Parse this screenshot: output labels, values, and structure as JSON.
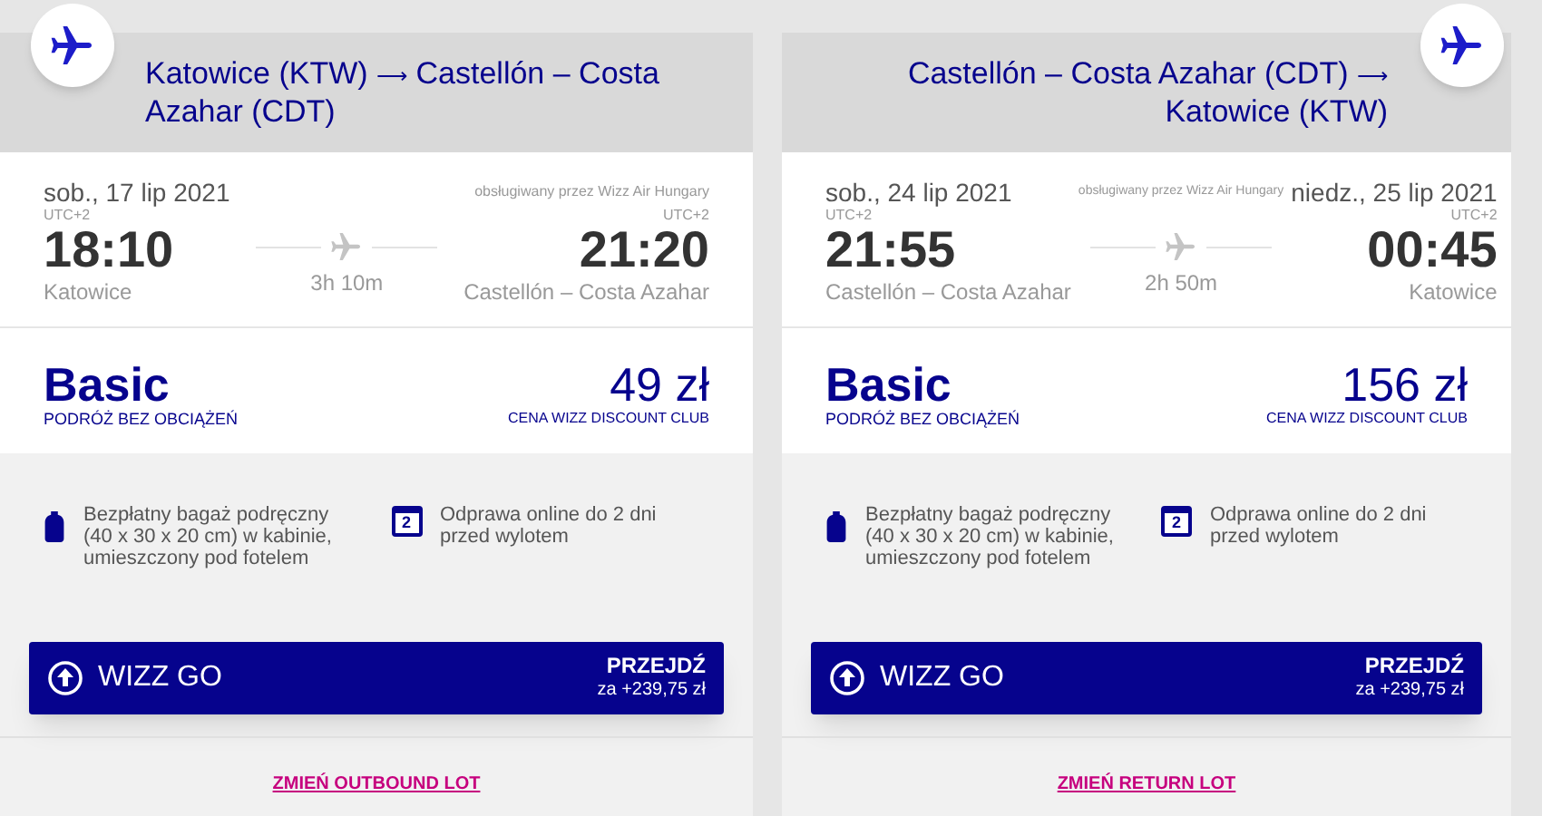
{
  "cards": [
    {
      "kind": "outbound",
      "route": {
        "from": "Katowice (KTW)",
        "arrow": "⟶",
        "to": "Castellón – Costa Azahar (CDT)"
      },
      "flight": {
        "departure": {
          "date": "sob., 17 lip 2021",
          "tz": "UTC+2",
          "time": "18:10",
          "city": "Katowice"
        },
        "arrival": {
          "tz": "UTC+2",
          "time": "21:20",
          "city": "Castellón – Costa Azahar"
        },
        "duration": "3h 10m",
        "operator": "obsługiwany przez Wizz Air Hungary"
      },
      "fare": {
        "name": "Basic",
        "subtitle": "PODRÓŻ BEZ OBCIĄŻEŃ",
        "price": "49 zł",
        "price_note": "CENA WIZZ DISCOUNT CLUB"
      },
      "features": [
        {
          "kind": "bag",
          "text": "Bezpłatny bagaż podręczny (40 x 30 x 20 cm) w kabinie, umieszczony pod fotelem"
        },
        {
          "kind": "calendar",
          "icon_text": "2",
          "text": "Odprawa online do 2 dni przed wylotem"
        }
      ],
      "upgrade": {
        "label": "WIZZ GO",
        "action": "PRZEJDŹ",
        "price": "za +239,75 zł"
      },
      "change_link": "ZMIEŃ OUTBOUND LOT"
    },
    {
      "kind": "return",
      "route": {
        "from": "Castellón – Costa Azahar (CDT)",
        "arrow": "⟶",
        "to": "Katowice (KTW)"
      },
      "flight": {
        "departure": {
          "date": "sob., 24 lip 2021",
          "tz": "UTC+2",
          "time": "21:55",
          "city": "Castellón – Costa Azahar"
        },
        "arrival": {
          "date": "niedz., 25 lip 2021",
          "tz": "UTC+2",
          "time": "00:45",
          "city": "Katowice"
        },
        "duration": "2h 50m",
        "operator": "obsługiwany przez Wizz Air Hungary"
      },
      "fare": {
        "name": "Basic",
        "subtitle": "PODRÓŻ BEZ OBCIĄŻEŃ",
        "price": "156 zł",
        "price_note": "CENA WIZZ DISCOUNT CLUB"
      },
      "features": [
        {
          "kind": "bag",
          "text": "Bezpłatny bagaż podręczny (40 x 30 x 20 cm) w kabinie, umieszczony pod fotelem"
        },
        {
          "kind": "calendar",
          "icon_text": "2",
          "text": "Odprawa online do 2 dni przed wylotem"
        }
      ],
      "upgrade": {
        "label": "WIZZ GO",
        "action": "PRZEJDŹ",
        "price": "za +239,75 zł"
      },
      "change_link": "ZMIEŃ RETURN LOT"
    }
  ]
}
